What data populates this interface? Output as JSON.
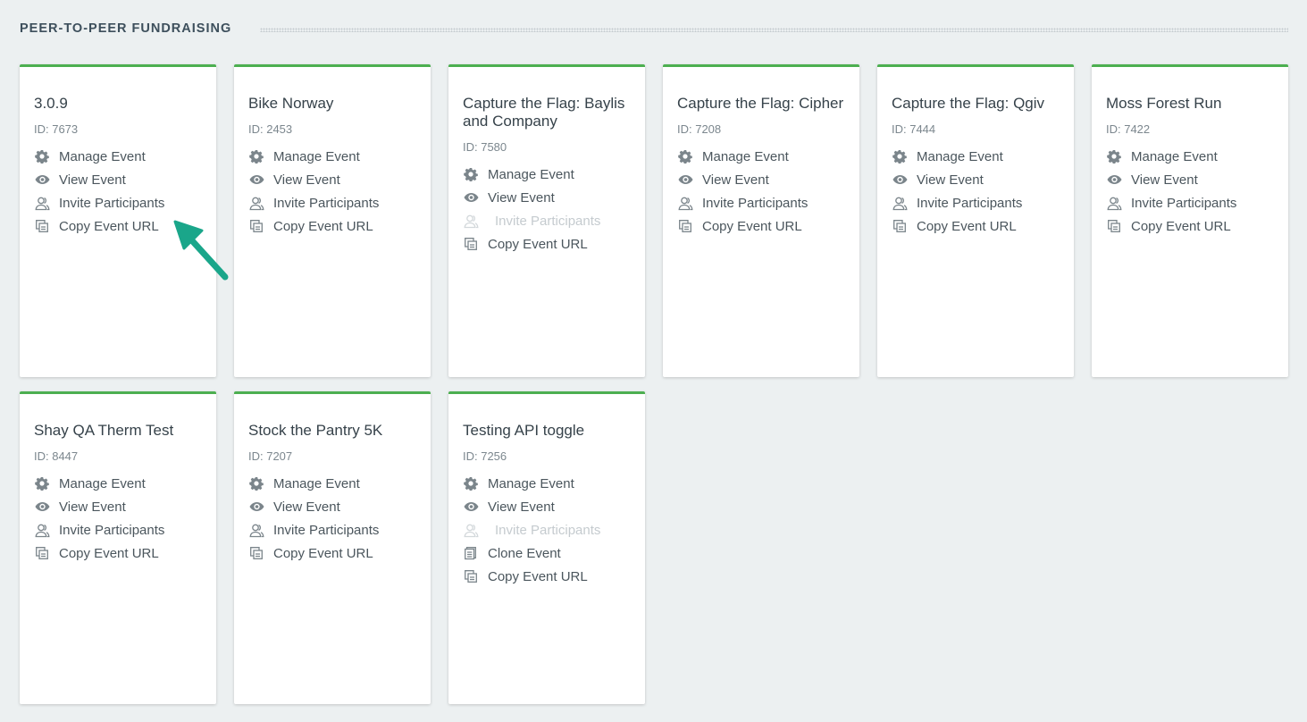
{
  "section": {
    "title": "PEER-TO-PEER FUNDRAISING"
  },
  "colors": {
    "accent": "#4caf50",
    "arrow": "#1aa68a"
  },
  "cards": [
    {
      "title": "3.0.9",
      "id_label": "ID: 7673",
      "actions": [
        {
          "label": "Manage Event",
          "icon": "gear-icon",
          "enabled": true
        },
        {
          "label": "View Event",
          "icon": "eye-icon",
          "enabled": true
        },
        {
          "label": "Invite Participants",
          "icon": "users-icon",
          "enabled": true
        },
        {
          "label": "Copy Event URL",
          "icon": "copy-icon",
          "enabled": true
        }
      ]
    },
    {
      "title": "Bike Norway",
      "id_label": "ID: 2453",
      "actions": [
        {
          "label": "Manage Event",
          "icon": "gear-icon",
          "enabled": true
        },
        {
          "label": "View Event",
          "icon": "eye-icon",
          "enabled": true
        },
        {
          "label": "Invite Participants",
          "icon": "users-icon",
          "enabled": true
        },
        {
          "label": "Copy Event URL",
          "icon": "copy-icon",
          "enabled": true
        }
      ]
    },
    {
      "title": "Capture the Flag: Baylis and Company",
      "id_label": "ID: 7580",
      "actions": [
        {
          "label": "Manage Event",
          "icon": "gear-icon",
          "enabled": true
        },
        {
          "label": "View Event",
          "icon": "eye-icon",
          "enabled": true
        },
        {
          "label": "Invite Participants",
          "icon": "users-icon",
          "enabled": false
        },
        {
          "label": "Copy Event URL",
          "icon": "copy-icon",
          "enabled": true
        }
      ]
    },
    {
      "title": "Capture the Flag: Cipher",
      "id_label": "ID: 7208",
      "actions": [
        {
          "label": "Manage Event",
          "icon": "gear-icon",
          "enabled": true
        },
        {
          "label": "View Event",
          "icon": "eye-icon",
          "enabled": true
        },
        {
          "label": "Invite Participants",
          "icon": "users-icon",
          "enabled": true
        },
        {
          "label": "Copy Event URL",
          "icon": "copy-icon",
          "enabled": true
        }
      ]
    },
    {
      "title": "Capture the Flag: Qgiv",
      "id_label": "ID: 7444",
      "actions": [
        {
          "label": "Manage Event",
          "icon": "gear-icon",
          "enabled": true
        },
        {
          "label": "View Event",
          "icon": "eye-icon",
          "enabled": true
        },
        {
          "label": "Invite Participants",
          "icon": "users-icon",
          "enabled": true
        },
        {
          "label": "Copy Event URL",
          "icon": "copy-icon",
          "enabled": true
        }
      ]
    },
    {
      "title": "Moss Forest Run",
      "id_label": "ID: 7422",
      "actions": [
        {
          "label": "Manage Event",
          "icon": "gear-icon",
          "enabled": true
        },
        {
          "label": "View Event",
          "icon": "eye-icon",
          "enabled": true
        },
        {
          "label": "Invite Participants",
          "icon": "users-icon",
          "enabled": true
        },
        {
          "label": "Copy Event URL",
          "icon": "copy-icon",
          "enabled": true
        }
      ]
    },
    {
      "title": "Shay QA Therm Test",
      "id_label": "ID: 8447",
      "actions": [
        {
          "label": "Manage Event",
          "icon": "gear-icon",
          "enabled": true
        },
        {
          "label": "View Event",
          "icon": "eye-icon",
          "enabled": true
        },
        {
          "label": "Invite Participants",
          "icon": "users-icon",
          "enabled": true
        },
        {
          "label": "Copy Event URL",
          "icon": "copy-icon",
          "enabled": true
        }
      ]
    },
    {
      "title": "Stock the Pantry 5K",
      "id_label": "ID: 7207",
      "actions": [
        {
          "label": "Manage Event",
          "icon": "gear-icon",
          "enabled": true
        },
        {
          "label": "View Event",
          "icon": "eye-icon",
          "enabled": true
        },
        {
          "label": "Invite Participants",
          "icon": "users-icon",
          "enabled": true
        },
        {
          "label": "Copy Event URL",
          "icon": "copy-icon",
          "enabled": true
        }
      ]
    },
    {
      "title": "Testing API toggle",
      "id_label": "ID: 7256",
      "actions": [
        {
          "label": "Manage Event",
          "icon": "gear-icon",
          "enabled": true
        },
        {
          "label": "View Event",
          "icon": "eye-icon",
          "enabled": true
        },
        {
          "label": "Invite Participants",
          "icon": "users-icon",
          "enabled": false
        },
        {
          "label": "Clone Event",
          "icon": "clone-icon",
          "enabled": true
        },
        {
          "label": "Copy Event URL",
          "icon": "copy-icon",
          "enabled": true
        }
      ]
    }
  ]
}
